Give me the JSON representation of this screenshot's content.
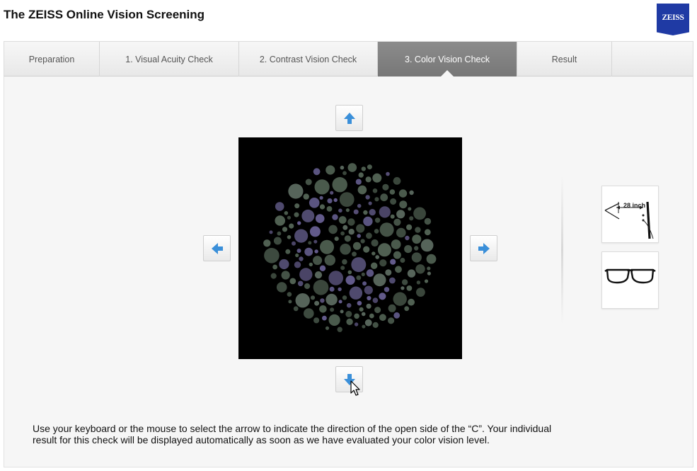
{
  "header": {
    "title": "The ZEISS Online Vision Screening",
    "logo_text": "ZEISS"
  },
  "tabs": [
    {
      "label": "Preparation",
      "active": false
    },
    {
      "label": "1. Visual Acuity Check",
      "active": false
    },
    {
      "label": "2. Contrast Vision Check",
      "active": false
    },
    {
      "label": "3. Color Vision Check",
      "active": true
    },
    {
      "label": "Result",
      "active": false
    }
  ],
  "side_panel": {
    "distance_label": "28 inch"
  },
  "instructions": "Use your keyboard or the mouse to select the arrow to indicate the direction of the open side of the “C”. Your individual result for this check will be displayed automatically as soon as we have evaluated your color vision level.",
  "colors": {
    "brand_blue": "#1f3aa4",
    "arrow_blue": "#3a8fd9",
    "active_tab": "#808080"
  }
}
